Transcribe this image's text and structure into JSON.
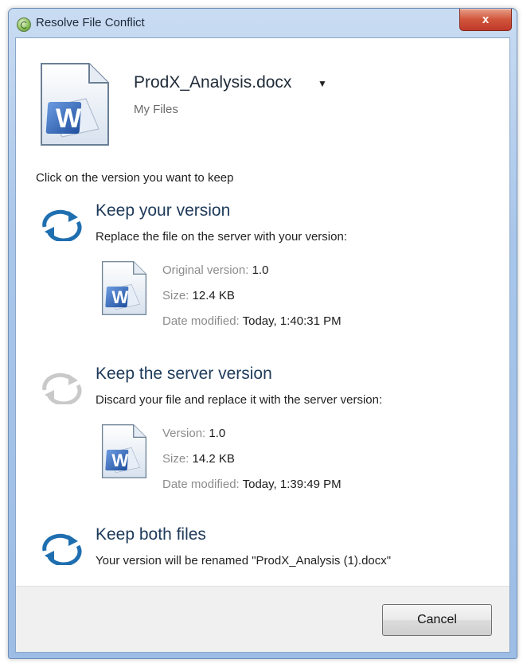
{
  "window": {
    "title": "Resolve File Conflict",
    "close_glyph": "x"
  },
  "file": {
    "name": "ProdX_Analysis.docx",
    "dropdown_glyph": "▼",
    "location": "My Files",
    "icon": "word-document-icon"
  },
  "instruction": "Click on the version you want to keep",
  "options": [
    {
      "title": "Keep your version",
      "description": "Replace the file on the server with your version:",
      "icon": "sync-icon",
      "details": [
        {
          "label": "Original version:",
          "value": "1.0"
        },
        {
          "label": "Size:",
          "value": "12.4 KB"
        },
        {
          "label": "Date modified:",
          "value": "Today, 1:40:31 PM"
        }
      ]
    },
    {
      "title": "Keep the server version",
      "description": "Discard your file and replace it with the server version:",
      "icon": "sync-icon",
      "details": [
        {
          "label": "Version:",
          "value": "1.0"
        },
        {
          "label": "Size:",
          "value": "14.2 KB"
        },
        {
          "label": "Date modified:",
          "value": "Today, 1:39:49 PM"
        }
      ]
    },
    {
      "title": "Keep both files",
      "description": "Your version will be renamed \"ProdX_Analysis (1).docx\"",
      "icon": "sync-icon"
    }
  ],
  "footer": {
    "cancel_label": "Cancel"
  },
  "colors": {
    "accent_blue": "#1f6fb0",
    "sync_grey": "#c9c9c9",
    "word_blue": "#2a5caa"
  }
}
